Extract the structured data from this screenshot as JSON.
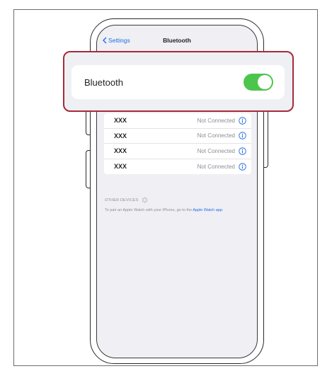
{
  "navbar": {
    "back_label": "Settings",
    "title": "Bluetooth"
  },
  "bluetooth": {
    "label": "Bluetooth",
    "enabled": true,
    "toggle_color": "#4cc54c"
  },
  "devices": [
    {
      "name": "XXX",
      "status": "Not Connected"
    },
    {
      "name": "XXX",
      "status": "Not Connected"
    },
    {
      "name": "XXX",
      "status": "Not Connected"
    },
    {
      "name": "XXX",
      "status": "Not Connected"
    }
  ],
  "other_devices": {
    "header": "OTHER DEVICES"
  },
  "note": {
    "text": "To pair an Apple Watch with your iPhone, go to the ",
    "link": "Apple Watch app",
    "suffix": "."
  },
  "colors": {
    "accent": "#1f6fe5",
    "highlight": "#a8293a"
  },
  "icons": {
    "back": "chevron-left-icon",
    "info": "info-icon",
    "spinner": "spinner-icon"
  }
}
